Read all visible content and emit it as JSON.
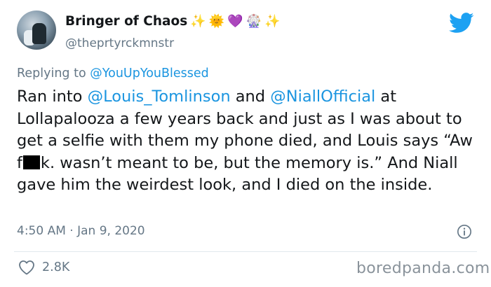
{
  "user": {
    "display_name": "Bringer of Chaos",
    "emojis": [
      "✨",
      "🌞",
      "💜",
      "🎡",
      "✨"
    ],
    "handle": "@theprtyrckmnstr",
    "avatar_icon": "user-avatar"
  },
  "brand": {
    "icon": "twitter-bird-icon",
    "color": "#1da1f2"
  },
  "reply": {
    "prefix": "Replying to",
    "to": "@YouUpYouBlessed"
  },
  "tweet": {
    "p1": "Ran into ",
    "mention1": "@Louis_Tomlinson",
    "p2": " and ",
    "mention2": "@NiallOfficial",
    "p3": " at Lollapalooza a few years back and just as I was about to get a selfie with them my phone died, and Louis says “Aw f",
    "p4": "k. wasn’t meant to be, but the memory is.” And Niall gave him the weirdest look, and I died on the inside."
  },
  "meta": {
    "time": "4:50 AM",
    "separator": " · ",
    "date": "Jan 9, 2020"
  },
  "actions": {
    "likes": "2.8K"
  },
  "watermark": "boredpanda.com",
  "colors": {
    "link": "#1b95e0",
    "muted": "#657786",
    "text": "#14171a"
  }
}
